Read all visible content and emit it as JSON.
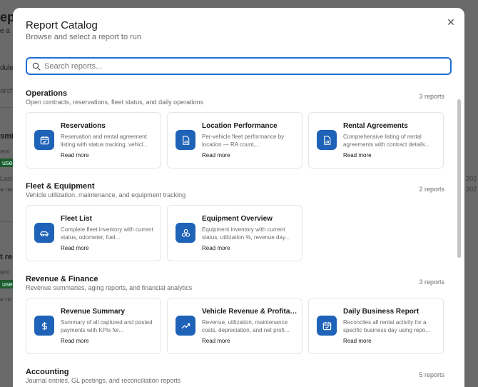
{
  "background": {
    "fragments": [
      "ep",
      "e a",
      "dule",
      "arch",
      "smi",
      "ievi",
      "Last",
      "a ne",
      "t rep",
      "ievi",
      "lusec",
      "e re",
      "202",
      "202"
    ],
    "badges": [
      "usec",
      "usec"
    ]
  },
  "modal": {
    "title": "Report Catalog",
    "subtitle": "Browse and select a report to run",
    "close_glyph": "✕"
  },
  "search": {
    "placeholder": "Search reports..."
  },
  "sections": [
    {
      "title": "Operations",
      "description": "Open contracts, reservations, fleet status, and daily operations",
      "count": "3 reports",
      "cards": [
        {
          "title": "Reservations",
          "description": "Reservation and rental agreement listing with status tracking, vehicl...",
          "link": "Read more",
          "icon": "calendar-check-icon"
        },
        {
          "title": "Location Performance",
          "description": "Per-vehicle fleet performance by location — RA count,...",
          "link": "Read more",
          "icon": "file-chart-icon"
        },
        {
          "title": "Rental Agreements",
          "description": "Comprehensive listing of rental agreements with contract details...",
          "link": "Read more",
          "icon": "file-chart-icon"
        }
      ]
    },
    {
      "title": "Fleet & Equipment",
      "description": "Vehicle utilization, maintenance, and equipment tracking",
      "count": "2 reports",
      "cards": [
        {
          "title": "Fleet List",
          "description": "Complete fleet inventory with current status, odometer, fuel...",
          "link": "Read more",
          "icon": "car-icon"
        },
        {
          "title": "Equipment Overview",
          "description": "Equipment inventory with current status, utilization %, revenue day...",
          "link": "Read more",
          "icon": "boxes-icon"
        }
      ]
    },
    {
      "title": "Revenue & Finance",
      "description": "Revenue summaries, aging reports, and financial analytics",
      "count": "3 reports",
      "cards": [
        {
          "title": "Revenue Summary",
          "description": "Summary of all captured and posted payments with KPIs for...",
          "link": "Read more",
          "icon": "dollar-icon"
        },
        {
          "title": "Vehicle Revenue & Profitab...",
          "description": "Revenue, utilization, maintenance costs, depreciation, and net profi...",
          "link": "Read more",
          "icon": "trending-up-icon"
        },
        {
          "title": "Daily Business Report",
          "description": "Reconciles all rental activity for a specific business day using repo...",
          "link": "Read more",
          "icon": "calendar-check-icon"
        }
      ]
    },
    {
      "title": "Accounting",
      "description": "Journal entries, GL postings, and reconciliation reports",
      "count": "5 reports",
      "cards": []
    }
  ]
}
